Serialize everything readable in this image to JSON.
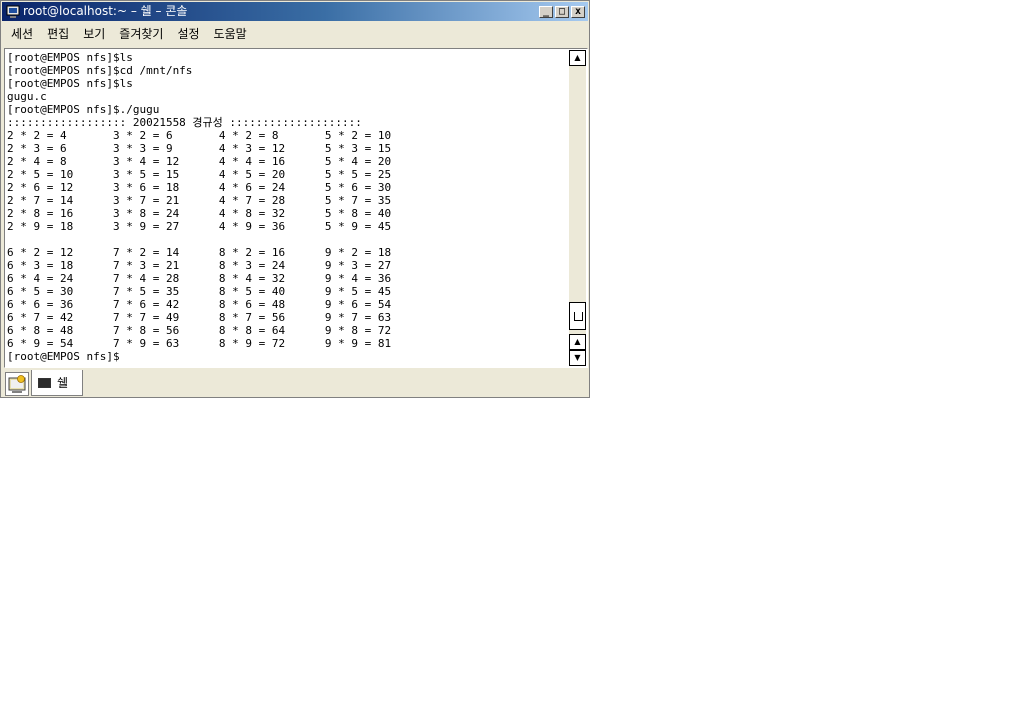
{
  "window": {
    "title": "root@localhost:~ – 쉘 – 콘솔",
    "controls": {
      "minimize": "_",
      "maximize": "□",
      "close": "x"
    }
  },
  "menubar": {
    "items": [
      {
        "label": "세션"
      },
      {
        "label": "편집"
      },
      {
        "label": "보기"
      },
      {
        "label": "즐겨찾기"
      },
      {
        "label": "설정"
      },
      {
        "label": "도움말"
      }
    ]
  },
  "terminal": {
    "lines": [
      "[root@EMPOS nfs]$ls",
      "[root@EMPOS nfs]$cd /mnt/nfs",
      "[root@EMPOS nfs]$ls",
      "gugu.c",
      "[root@EMPOS nfs]$./gugu",
      ":::::::::::::::::: 20021558 경규성 ::::::::::::::::::::",
      "2 * 2 = 4       3 * 2 = 6       4 * 2 = 8       5 * 2 = 10",
      "2 * 3 = 6       3 * 3 = 9       4 * 3 = 12      5 * 3 = 15",
      "2 * 4 = 8       3 * 4 = 12      4 * 4 = 16      5 * 4 = 20",
      "2 * 5 = 10      3 * 5 = 15      4 * 5 = 20      5 * 5 = 25",
      "2 * 6 = 12      3 * 6 = 18      4 * 6 = 24      5 * 6 = 30",
      "2 * 7 = 14      3 * 7 = 21      4 * 7 = 28      5 * 7 = 35",
      "2 * 8 = 16      3 * 8 = 24      4 * 8 = 32      5 * 8 = 40",
      "2 * 9 = 18      3 * 9 = 27      4 * 9 = 36      5 * 9 = 45",
      "",
      "6 * 2 = 12      7 * 2 = 14      8 * 2 = 16      9 * 2 = 18",
      "6 * 3 = 18      7 * 3 = 21      8 * 3 = 24      9 * 3 = 27",
      "6 * 4 = 24      7 * 4 = 28      8 * 4 = 32      9 * 4 = 36",
      "6 * 5 = 30      7 * 5 = 35      8 * 5 = 40      9 * 5 = 45",
      "6 * 6 = 36      7 * 6 = 42      8 * 6 = 48      9 * 6 = 54",
      "6 * 7 = 42      7 * 7 = 49      8 * 7 = 56      9 * 7 = 63",
      "6 * 8 = 48      7 * 8 = 56      8 * 8 = 64      9 * 8 = 72",
      "6 * 9 = 54      7 * 9 = 63      8 * 9 = 72      9 * 9 = 81",
      "[root@EMPOS nfs]$"
    ]
  },
  "tabbar": {
    "tabs": [
      {
        "label": "쉘",
        "icon": "terminal-icon"
      }
    ],
    "new_session_icon": "new-session-icon"
  },
  "colors": {
    "titlebar_start": "#0a246a",
    "titlebar_end": "#a6caf0",
    "chrome": "#ece9d8"
  }
}
